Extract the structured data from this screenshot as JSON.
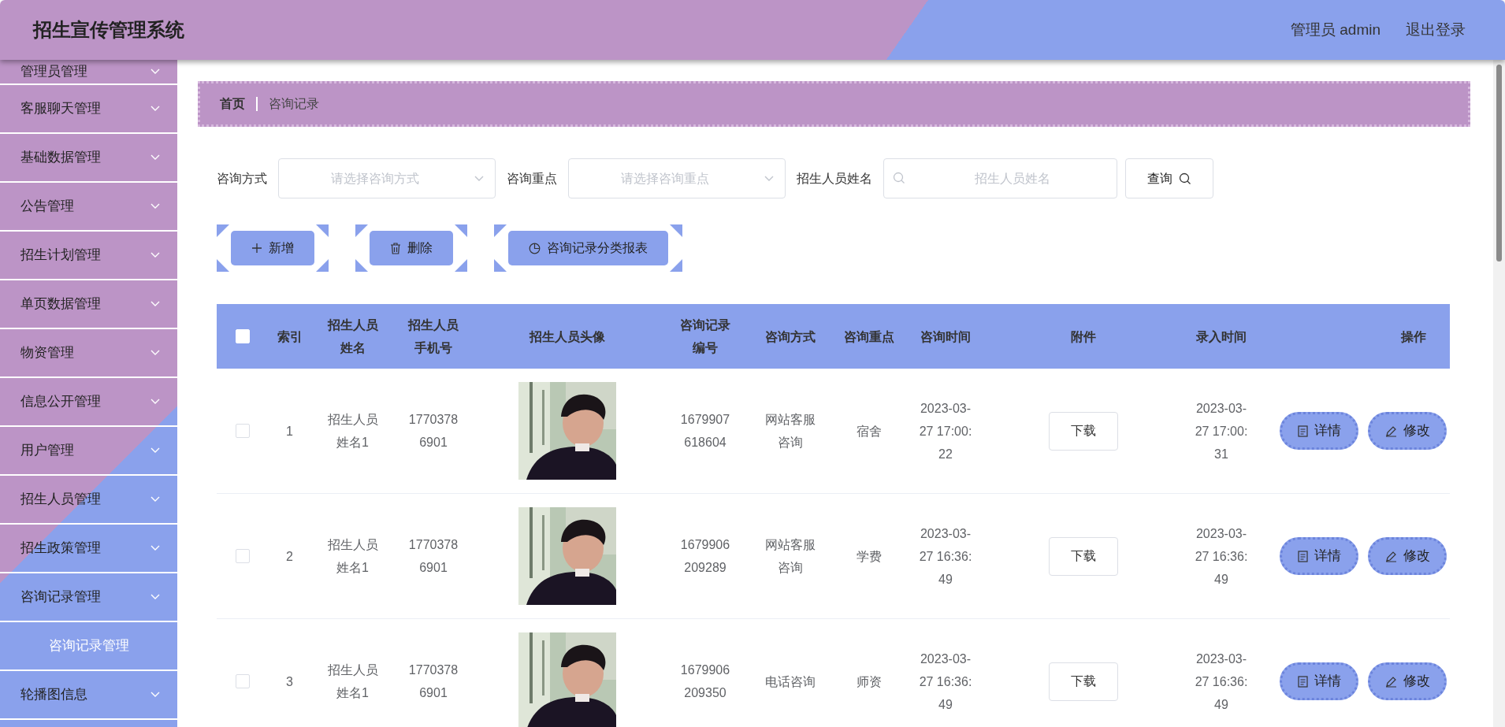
{
  "header": {
    "title": "招生宣传管理系统",
    "user_label": "管理员 admin",
    "logout": "退出登录"
  },
  "sidebar": {
    "items": [
      {
        "label": "管理员管理"
      },
      {
        "label": "客服聊天管理"
      },
      {
        "label": "基础数据管理"
      },
      {
        "label": "公告管理"
      },
      {
        "label": "招生计划管理"
      },
      {
        "label": "单页数据管理"
      },
      {
        "label": "物资管理"
      },
      {
        "label": "信息公开管理"
      },
      {
        "label": "用户管理"
      },
      {
        "label": "招生人员管理"
      },
      {
        "label": "招生政策管理"
      },
      {
        "label": "咨询记录管理",
        "children": [
          {
            "label": "咨询记录管理",
            "selected": true
          }
        ]
      },
      {
        "label": "轮播图信息"
      }
    ]
  },
  "breadcrumb": [
    {
      "label": "首页"
    },
    {
      "label": "咨询记录"
    }
  ],
  "filters": [
    {
      "kind": "select",
      "label": "咨询方式",
      "placeholder": "请选择咨询方式"
    },
    {
      "kind": "select",
      "label": "咨询重点",
      "placeholder": "请选择咨询重点"
    },
    {
      "kind": "search",
      "label": "招生人员姓名",
      "placeholder": "招生人员姓名"
    }
  ],
  "query_button": "查询",
  "actions": [
    {
      "kind": "plus",
      "label": "新增"
    },
    {
      "kind": "trash",
      "label": "删除"
    },
    {
      "kind": "pie",
      "label": "咨询记录分类报表"
    }
  ],
  "table": {
    "all_checked": false,
    "columns": [
      "索引",
      "招生人员姓名",
      "招生人员手机号",
      "招生人员头像",
      "咨询记录编号",
      "咨询方式",
      "咨询重点",
      "咨询时间",
      "附件",
      "录入时间",
      "操作"
    ],
    "rows": [
      {
        "checked": false,
        "index": "1",
        "name": "招生人员姓名1",
        "phone": "17703786901",
        "avatar": {
          "kind": "picture"
        },
        "number": "1679907618604",
        "method": "网站客服咨询",
        "focus": "宿舍",
        "time": "2023-03-27 17:00:22",
        "attachment": "下载",
        "created": "2023-03-27 17:00:31",
        "ops": [
          "详情",
          "修改"
        ]
      },
      {
        "checked": false,
        "index": "2",
        "name": "招生人员姓名1",
        "phone": "17703786901",
        "avatar": {
          "kind": "picture"
        },
        "number": "1679906209289",
        "method": "网站客服咨询",
        "focus": "学费",
        "time": "2023-03-27 16:36:49",
        "attachment": "下载",
        "created": "2023-03-27 16:36:49",
        "ops": [
          "详情",
          "修改"
        ]
      },
      {
        "checked": false,
        "index": "3",
        "name": "招生人员姓名1",
        "phone": "17703786901",
        "avatar": {
          "kind": "picture"
        },
        "number": "1679906209350",
        "method": "电话咨询",
        "focus": "师资",
        "time": "2023-03-27 16:36:49",
        "attachment": "下载",
        "created": "2023-03-27 16:36:49",
        "ops": [
          "详情",
          "修改"
        ]
      }
    ]
  }
}
